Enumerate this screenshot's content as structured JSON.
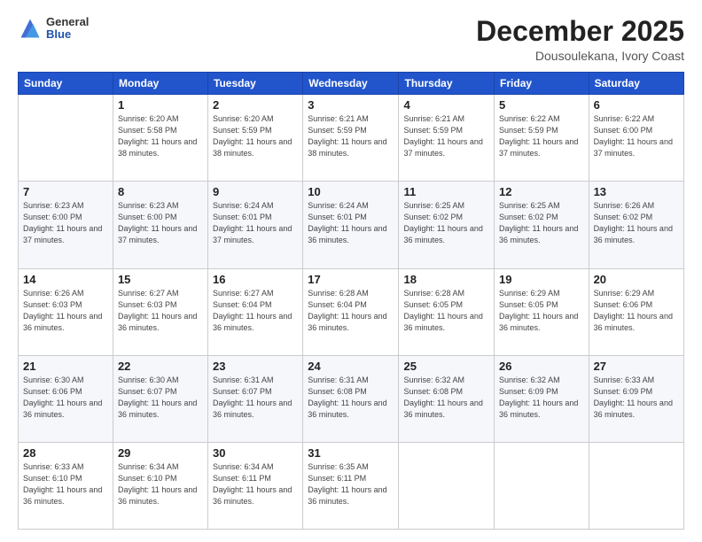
{
  "header": {
    "logo": {
      "general": "General",
      "blue": "Blue"
    },
    "title": "December 2025",
    "subtitle": "Dousoulekana, Ivory Coast"
  },
  "days_of_week": [
    "Sunday",
    "Monday",
    "Tuesday",
    "Wednesday",
    "Thursday",
    "Friday",
    "Saturday"
  ],
  "weeks": [
    [
      {
        "day": "",
        "sunrise": "",
        "sunset": "",
        "daylight": ""
      },
      {
        "day": "1",
        "sunrise": "Sunrise: 6:20 AM",
        "sunset": "Sunset: 5:58 PM",
        "daylight": "Daylight: 11 hours and 38 minutes."
      },
      {
        "day": "2",
        "sunrise": "Sunrise: 6:20 AM",
        "sunset": "Sunset: 5:59 PM",
        "daylight": "Daylight: 11 hours and 38 minutes."
      },
      {
        "day": "3",
        "sunrise": "Sunrise: 6:21 AM",
        "sunset": "Sunset: 5:59 PM",
        "daylight": "Daylight: 11 hours and 38 minutes."
      },
      {
        "day": "4",
        "sunrise": "Sunrise: 6:21 AM",
        "sunset": "Sunset: 5:59 PM",
        "daylight": "Daylight: 11 hours and 37 minutes."
      },
      {
        "day": "5",
        "sunrise": "Sunrise: 6:22 AM",
        "sunset": "Sunset: 5:59 PM",
        "daylight": "Daylight: 11 hours and 37 minutes."
      },
      {
        "day": "6",
        "sunrise": "Sunrise: 6:22 AM",
        "sunset": "Sunset: 6:00 PM",
        "daylight": "Daylight: 11 hours and 37 minutes."
      }
    ],
    [
      {
        "day": "7",
        "sunrise": "Sunrise: 6:23 AM",
        "sunset": "Sunset: 6:00 PM",
        "daylight": "Daylight: 11 hours and 37 minutes."
      },
      {
        "day": "8",
        "sunrise": "Sunrise: 6:23 AM",
        "sunset": "Sunset: 6:00 PM",
        "daylight": "Daylight: 11 hours and 37 minutes."
      },
      {
        "day": "9",
        "sunrise": "Sunrise: 6:24 AM",
        "sunset": "Sunset: 6:01 PM",
        "daylight": "Daylight: 11 hours and 37 minutes."
      },
      {
        "day": "10",
        "sunrise": "Sunrise: 6:24 AM",
        "sunset": "Sunset: 6:01 PM",
        "daylight": "Daylight: 11 hours and 36 minutes."
      },
      {
        "day": "11",
        "sunrise": "Sunrise: 6:25 AM",
        "sunset": "Sunset: 6:02 PM",
        "daylight": "Daylight: 11 hours and 36 minutes."
      },
      {
        "day": "12",
        "sunrise": "Sunrise: 6:25 AM",
        "sunset": "Sunset: 6:02 PM",
        "daylight": "Daylight: 11 hours and 36 minutes."
      },
      {
        "day": "13",
        "sunrise": "Sunrise: 6:26 AM",
        "sunset": "Sunset: 6:02 PM",
        "daylight": "Daylight: 11 hours and 36 minutes."
      }
    ],
    [
      {
        "day": "14",
        "sunrise": "Sunrise: 6:26 AM",
        "sunset": "Sunset: 6:03 PM",
        "daylight": "Daylight: 11 hours and 36 minutes."
      },
      {
        "day": "15",
        "sunrise": "Sunrise: 6:27 AM",
        "sunset": "Sunset: 6:03 PM",
        "daylight": "Daylight: 11 hours and 36 minutes."
      },
      {
        "day": "16",
        "sunrise": "Sunrise: 6:27 AM",
        "sunset": "Sunset: 6:04 PM",
        "daylight": "Daylight: 11 hours and 36 minutes."
      },
      {
        "day": "17",
        "sunrise": "Sunrise: 6:28 AM",
        "sunset": "Sunset: 6:04 PM",
        "daylight": "Daylight: 11 hours and 36 minutes."
      },
      {
        "day": "18",
        "sunrise": "Sunrise: 6:28 AM",
        "sunset": "Sunset: 6:05 PM",
        "daylight": "Daylight: 11 hours and 36 minutes."
      },
      {
        "day": "19",
        "sunrise": "Sunrise: 6:29 AM",
        "sunset": "Sunset: 6:05 PM",
        "daylight": "Daylight: 11 hours and 36 minutes."
      },
      {
        "day": "20",
        "sunrise": "Sunrise: 6:29 AM",
        "sunset": "Sunset: 6:06 PM",
        "daylight": "Daylight: 11 hours and 36 minutes."
      }
    ],
    [
      {
        "day": "21",
        "sunrise": "Sunrise: 6:30 AM",
        "sunset": "Sunset: 6:06 PM",
        "daylight": "Daylight: 11 hours and 36 minutes."
      },
      {
        "day": "22",
        "sunrise": "Sunrise: 6:30 AM",
        "sunset": "Sunset: 6:07 PM",
        "daylight": "Daylight: 11 hours and 36 minutes."
      },
      {
        "day": "23",
        "sunrise": "Sunrise: 6:31 AM",
        "sunset": "Sunset: 6:07 PM",
        "daylight": "Daylight: 11 hours and 36 minutes."
      },
      {
        "day": "24",
        "sunrise": "Sunrise: 6:31 AM",
        "sunset": "Sunset: 6:08 PM",
        "daylight": "Daylight: 11 hours and 36 minutes."
      },
      {
        "day": "25",
        "sunrise": "Sunrise: 6:32 AM",
        "sunset": "Sunset: 6:08 PM",
        "daylight": "Daylight: 11 hours and 36 minutes."
      },
      {
        "day": "26",
        "sunrise": "Sunrise: 6:32 AM",
        "sunset": "Sunset: 6:09 PM",
        "daylight": "Daylight: 11 hours and 36 minutes."
      },
      {
        "day": "27",
        "sunrise": "Sunrise: 6:33 AM",
        "sunset": "Sunset: 6:09 PM",
        "daylight": "Daylight: 11 hours and 36 minutes."
      }
    ],
    [
      {
        "day": "28",
        "sunrise": "Sunrise: 6:33 AM",
        "sunset": "Sunset: 6:10 PM",
        "daylight": "Daylight: 11 hours and 36 minutes."
      },
      {
        "day": "29",
        "sunrise": "Sunrise: 6:34 AM",
        "sunset": "Sunset: 6:10 PM",
        "daylight": "Daylight: 11 hours and 36 minutes."
      },
      {
        "day": "30",
        "sunrise": "Sunrise: 6:34 AM",
        "sunset": "Sunset: 6:11 PM",
        "daylight": "Daylight: 11 hours and 36 minutes."
      },
      {
        "day": "31",
        "sunrise": "Sunrise: 6:35 AM",
        "sunset": "Sunset: 6:11 PM",
        "daylight": "Daylight: 11 hours and 36 minutes."
      },
      {
        "day": "",
        "sunrise": "",
        "sunset": "",
        "daylight": ""
      },
      {
        "day": "",
        "sunrise": "",
        "sunset": "",
        "daylight": ""
      },
      {
        "day": "",
        "sunrise": "",
        "sunset": "",
        "daylight": ""
      }
    ]
  ]
}
